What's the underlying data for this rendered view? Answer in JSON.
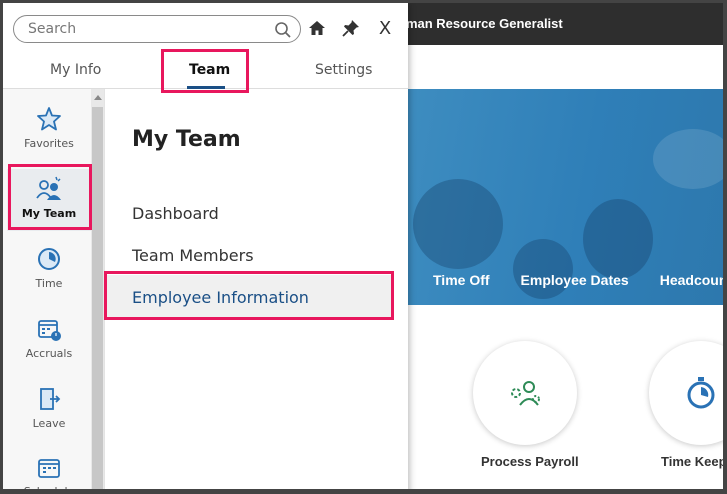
{
  "app": {
    "title": "uman Resource Generalist",
    "hero_links": [
      "Time Off",
      "Employee Dates",
      "Headcount"
    ],
    "tiles": [
      {
        "label": "Process Payroll",
        "icon": "payroll-gear-person-icon"
      },
      {
        "label": "Time Keep",
        "icon": "stopwatch-icon"
      }
    ]
  },
  "panel": {
    "search": {
      "placeholder": "Search"
    },
    "top_icons": [
      "home-icon",
      "pin-icon",
      "close-icon"
    ],
    "close_glyph": "X",
    "tabs": [
      {
        "label": "My Info",
        "active": false
      },
      {
        "label": "Team",
        "active": true
      },
      {
        "label": "Settings",
        "active": false
      }
    ],
    "rail": [
      {
        "label": "Favorites",
        "icon": "star-icon",
        "active": false
      },
      {
        "label": "My Team",
        "icon": "team-icon",
        "active": true
      },
      {
        "label": "Time",
        "icon": "clock-icon",
        "active": false
      },
      {
        "label": "Accruals",
        "icon": "calendar-clock-icon",
        "active": false
      },
      {
        "label": "Leave",
        "icon": "door-exit-icon",
        "active": false
      },
      {
        "label": "Schedule",
        "icon": "calendar-icon",
        "active": false
      }
    ],
    "content": {
      "title": "My Team",
      "links": [
        {
          "label": "Dashboard",
          "selected": false
        },
        {
          "label": "Team Members",
          "selected": false
        },
        {
          "label": "Employee Information",
          "selected": true
        }
      ]
    }
  },
  "colors": {
    "accent": "#1a4f86",
    "highlight": "#e8175d",
    "hero": "#2f7fb8",
    "icon_blue": "#2a72b5",
    "icon_green": "#2e8b57"
  }
}
